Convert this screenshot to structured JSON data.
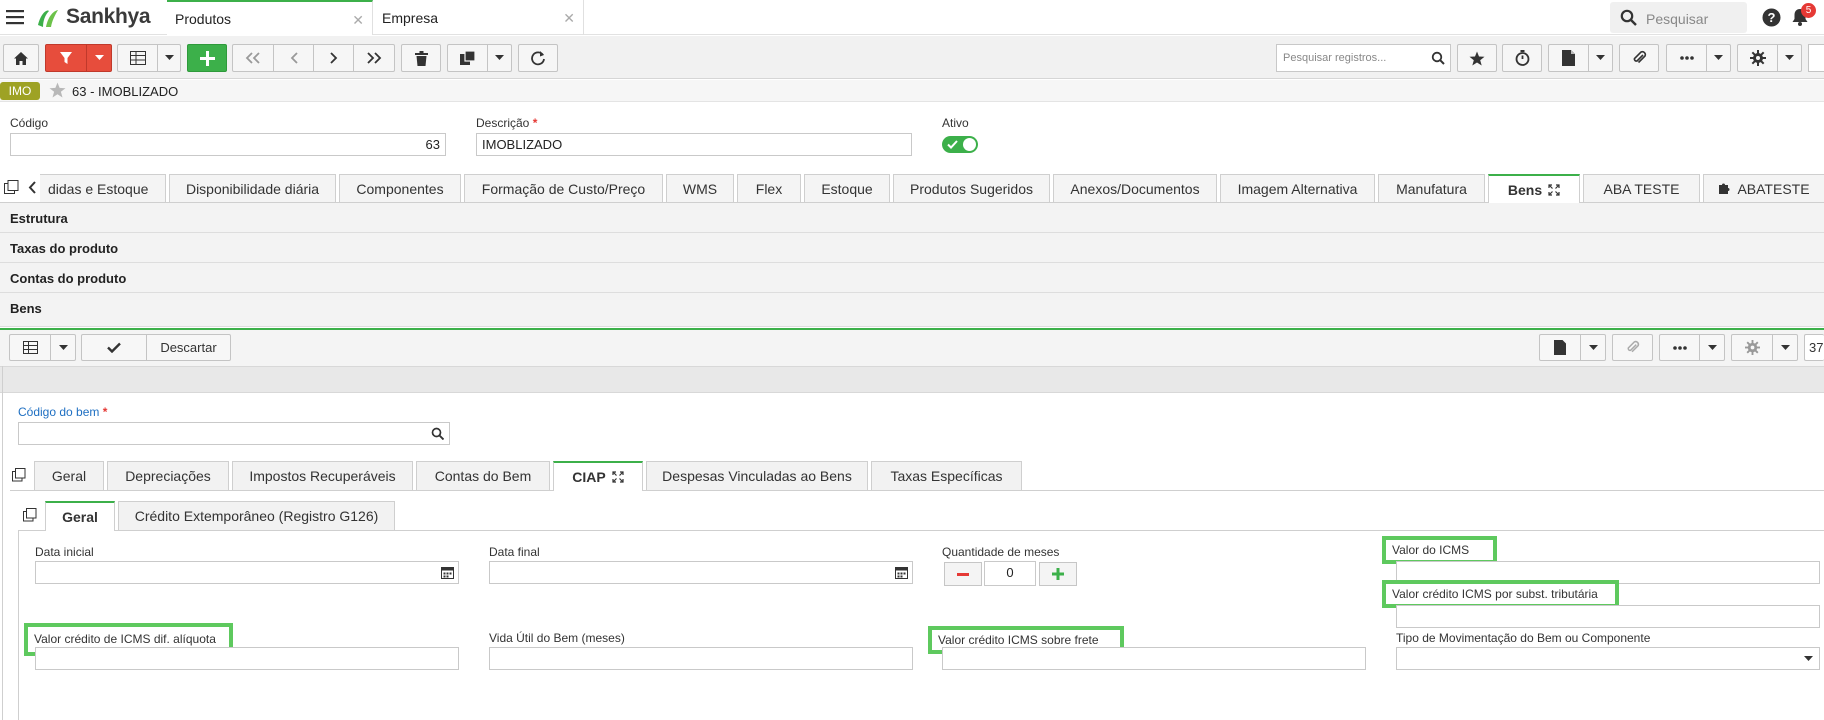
{
  "app": {
    "name": "Sankhya"
  },
  "doc_tabs": [
    {
      "label": "Produtos"
    },
    {
      "label": "Empresa"
    }
  ],
  "header": {
    "search_placeholder": "Pesquisar",
    "notification_count": "5"
  },
  "toolbar": {
    "search_placeholder": "Pesquisar registros..."
  },
  "breadcrumb": {
    "badge": "IMO",
    "title": "63 - IMOBLIZADO"
  },
  "form": {
    "codigo_label": "Código",
    "codigo_value": "63",
    "descricao_label": "Descrição",
    "descricao_value": "IMOBLIZADO",
    "ativo_label": "Ativo"
  },
  "tabs_main": [
    {
      "label": "didas e Estoque"
    },
    {
      "label": "Disponibilidade diária"
    },
    {
      "label": "Componentes"
    },
    {
      "label": "Formação de Custo/Preço"
    },
    {
      "label": "WMS"
    },
    {
      "label": "Flex"
    },
    {
      "label": "Estoque"
    },
    {
      "label": "Produtos Sugeridos"
    },
    {
      "label": "Anexos/Documentos"
    },
    {
      "label": "Imagem Alternativa"
    },
    {
      "label": "Manufatura"
    },
    {
      "label": "Bens"
    },
    {
      "label": "ABA TESTE"
    },
    {
      "label": "ABATESTE"
    }
  ],
  "sections": [
    {
      "label": "Estrutura"
    },
    {
      "label": "Taxas do produto"
    },
    {
      "label": "Contas do produto"
    },
    {
      "label": "Bens"
    }
  ],
  "inner_toolbar": {
    "discard_label": "Descartar",
    "page_number": "37"
  },
  "bem": {
    "codigo_label": "Código do bem"
  },
  "tabs_bem": [
    {
      "label": "Geral"
    },
    {
      "label": "Depreciações"
    },
    {
      "label": "Impostos Recuperáveis"
    },
    {
      "label": "Contas do Bem"
    },
    {
      "label": "CIAP"
    },
    {
      "label": "Despesas Vinculadas ao Bens"
    },
    {
      "label": "Taxas Específicas"
    }
  ],
  "tabs_ciap": [
    {
      "label": "Geral"
    },
    {
      "label": "Crédito Extemporâneo (Registro G126)"
    }
  ],
  "ciap": {
    "data_inicial_label": "Data inicial",
    "data_final_label": "Data final",
    "quantidade_meses_label": "Quantidade de meses",
    "quantidade_meses_value": "0",
    "valor_icms_label": "Valor do ICMS",
    "valor_credito_subst_label": "Valor crédito ICMS por subst. tributária",
    "valor_credito_dif_label": "Valor crédito de ICMS dif. alíquota",
    "vida_util_label": "Vida Útil do Bem (meses)",
    "valor_credito_frete_label": "Valor crédito ICMS sobre frete",
    "tipo_movimentacao_label": "Tipo de Movimentação do Bem ou Componente"
  },
  "colors": {
    "accent_green": "#3cb04a",
    "filter_red": "#e74d3c",
    "badge_olive": "#9ea224",
    "highlight": "#5ec95e"
  }
}
